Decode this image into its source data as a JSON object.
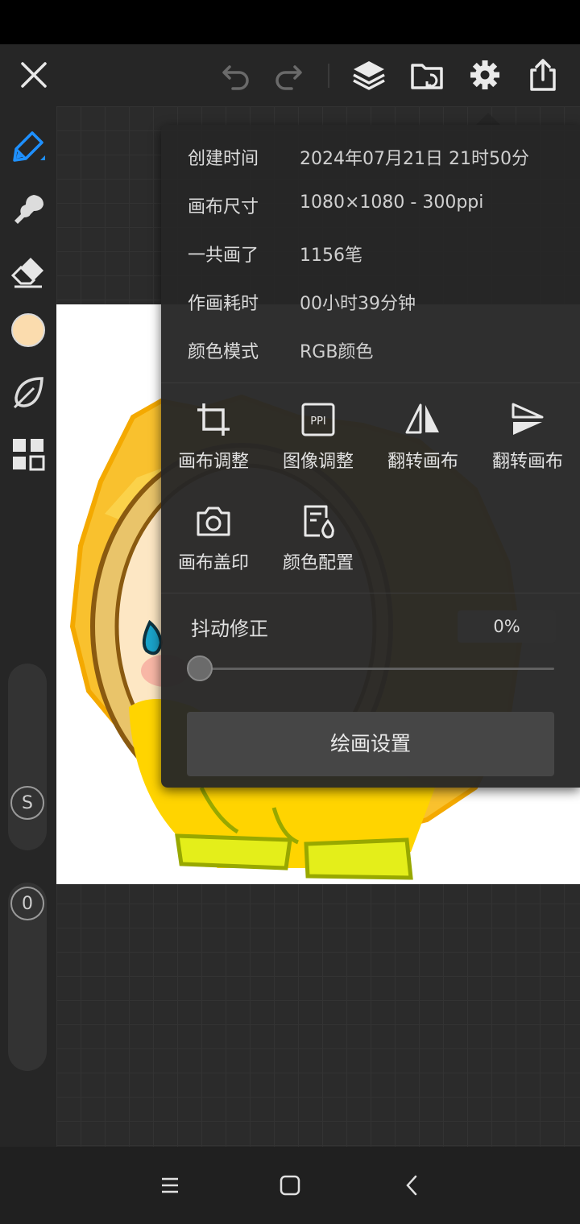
{
  "colors": {
    "accent": "#1e90ff",
    "current_color": "#fbdcae",
    "panel_bg": "#262626",
    "canvas_bg": "#ffffff"
  },
  "topbar": {
    "icons": [
      "close-icon",
      "undo-icon",
      "redo-icon",
      "layers-icon",
      "folder-import-icon",
      "gear-icon",
      "share-icon"
    ]
  },
  "toolbar": {
    "icons": [
      "pen-brush-icon",
      "smudge-icon",
      "eraser-icon",
      "color-swatch",
      "leaf-icon",
      "grid-apps-icon"
    ],
    "size_badge": "S",
    "opacity_badge": "0"
  },
  "info": {
    "rows": [
      {
        "label": "创建时间",
        "value": "2024年07月21日 21时50分"
      },
      {
        "label": "画布尺寸",
        "value": "1080×1080 - 300ppi"
      },
      {
        "label": "一共画了",
        "value": "1156笔"
      },
      {
        "label": "作画耗时",
        "value": "00小时39分钟"
      },
      {
        "label": "颜色模式",
        "value": "RGB颜色"
      }
    ]
  },
  "tools": {
    "row1": [
      {
        "label": "画布调整",
        "icon": "crop-icon"
      },
      {
        "label": "图像调整",
        "icon": "ppi-icon"
      },
      {
        "label": "翻转画布",
        "icon": "flip-horizontal-icon"
      },
      {
        "label": "翻转画布",
        "icon": "flip-vertical-icon"
      }
    ],
    "row2": [
      {
        "label": "画布盖印",
        "icon": "camera-icon"
      },
      {
        "label": "颜色配置",
        "icon": "color-profile-icon"
      }
    ],
    "ppi_text": "PPI"
  },
  "stabilizer": {
    "label": "抖动修正",
    "value": "0%",
    "level": 0
  },
  "settings_button": "绘画设置",
  "navbar": {
    "icons": [
      "menu-icon",
      "home-icon",
      "back-icon"
    ]
  }
}
